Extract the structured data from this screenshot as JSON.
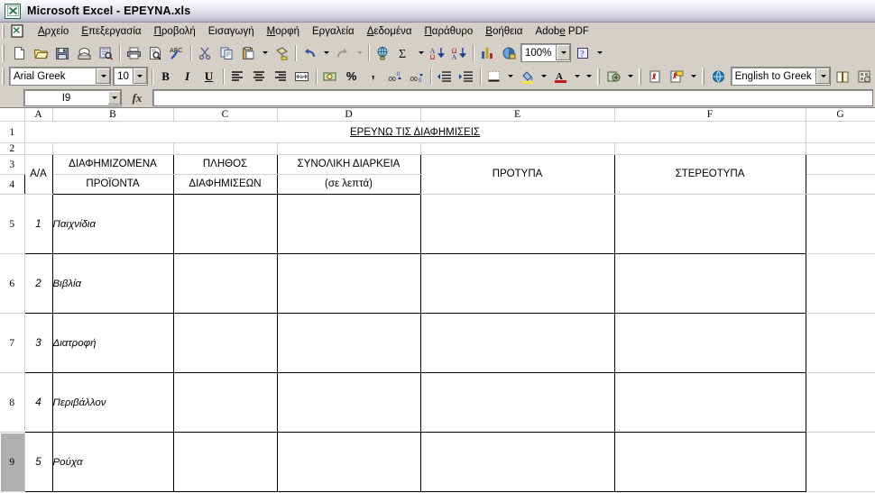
{
  "window": {
    "title": "Microsoft Excel - EPEYNA.xls",
    "app_icon": "excel-icon"
  },
  "menubar": {
    "doc_icon": "document-icon",
    "items": [
      {
        "label": "Αρχείο",
        "name": "menu-file"
      },
      {
        "label": "Επεξεργασία",
        "name": "menu-edit"
      },
      {
        "label": "Προβολή",
        "name": "menu-view"
      },
      {
        "label": "Εισαγωγή",
        "name": "menu-insert"
      },
      {
        "label": "Μορφή",
        "name": "menu-format"
      },
      {
        "label": "Εργαλεία",
        "name": "menu-tools"
      },
      {
        "label": "Δεδομένα",
        "name": "menu-data"
      },
      {
        "label": "Παράθυρο",
        "name": "menu-window"
      },
      {
        "label": "Βοήθεια",
        "name": "menu-help"
      },
      {
        "label": "Adobe PDF",
        "name": "menu-adobe-pdf"
      }
    ]
  },
  "standard_toolbar": {
    "buttons": [
      "new-document-icon",
      "open-folder-icon",
      "save-disk-icon",
      "email-icon",
      "search-icon",
      "print-icon",
      "print-preview-icon",
      "spelling-check-icon",
      "cut-scissors-icon",
      "copy-icon",
      "paste-icon",
      "format-painter-icon",
      "undo-icon",
      "redo-icon",
      "hyperlink-icon",
      "autosum-icon",
      "sort-ascending-icon",
      "sort-descending-icon",
      "chart-wizard-icon",
      "drawing-icon",
      "help-icon"
    ]
  },
  "formatting_toolbar": {
    "font_name": "Arial Greek",
    "font_size": "10",
    "bold_label": "B",
    "italic_label": "I",
    "underline_label": "U",
    "buttons": [
      "align-left-icon",
      "align-center-icon",
      "align-right-icon",
      "merge-center-icon",
      "currency-icon",
      "percent-icon",
      "comma-icon",
      "increase-decimal-icon",
      "decrease-decimal-icon",
      "decrease-indent-icon",
      "increase-indent-icon",
      "borders-icon",
      "fill-color-icon",
      "font-color-icon"
    ]
  },
  "zoom_toolbar": {
    "zoom_level": "100%"
  },
  "adobe_toolbar": {
    "buttons": [
      "convert-to-pdf-icon",
      "pdf-icon",
      "pdf-comment-icon"
    ]
  },
  "translation_toolbar": {
    "direction": "English to Greek",
    "buttons": [
      "translate-globe-icon",
      "dictionary-icon",
      "translate-settings-icon"
    ]
  },
  "formula_bar": {
    "name_box_value": "I9",
    "formula_value": "",
    "fx_label": "fx"
  },
  "sheet": {
    "column_headers": [
      "A",
      "B",
      "C",
      "D",
      "E",
      "F",
      "G"
    ],
    "row_headers": [
      "1",
      "2",
      "3",
      "4",
      "5",
      "6",
      "7",
      "8",
      "9"
    ],
    "selected_cell": "I9",
    "selected_row": "9",
    "title": "ΕΡΕΥΝΩ ΤΙΣ ΔΙΑΦΗΜΙΣΕΙΣ",
    "table_headers": {
      "aa": "Α/Α",
      "products_line1": "ΔΙΑΦΗΜΙΖΟΜΕΝΑ",
      "products_line2": "ΠΡΟΪΟΝΤΑ",
      "count_line1": "ΠΛΗΘΟΣ",
      "count_line2": "ΔΙΑΦΗΜΙΣΕΩΝ",
      "duration_line1": "ΣΥΝΟΛΙΚΗ ΔΙΑΡΚΕΙΑ",
      "duration_line2": "(σε λεπτά)",
      "patterns": "ΠΡΟΤΥΠΑ",
      "stereotypes": "ΣΤΕΡΕΟΤΥΠΑ"
    },
    "rows": [
      {
        "no": "1",
        "product": "Παιχνίδια",
        "count": "",
        "duration": "",
        "patterns": "",
        "stereotypes": ""
      },
      {
        "no": "2",
        "product": "Βιβλία",
        "count": "",
        "duration": "",
        "patterns": "",
        "stereotypes": ""
      },
      {
        "no": "3",
        "product": "Διατροφή",
        "count": "",
        "duration": "",
        "patterns": "",
        "stereotypes": ""
      },
      {
        "no": "4",
        "product": "Περιβάλλον",
        "count": "",
        "duration": "",
        "patterns": "",
        "stereotypes": ""
      },
      {
        "no": "5",
        "product": "Ρούχα",
        "count": "",
        "duration": "",
        "patterns": "",
        "stereotypes": ""
      }
    ]
  },
  "colors": {
    "chrome": "#d4d0c8",
    "grid_line": "#d0d0d0",
    "header_bg": "#d4d0c8",
    "selected_row_bg": "#b0b0b0",
    "excel_green": "#1a7040"
  }
}
